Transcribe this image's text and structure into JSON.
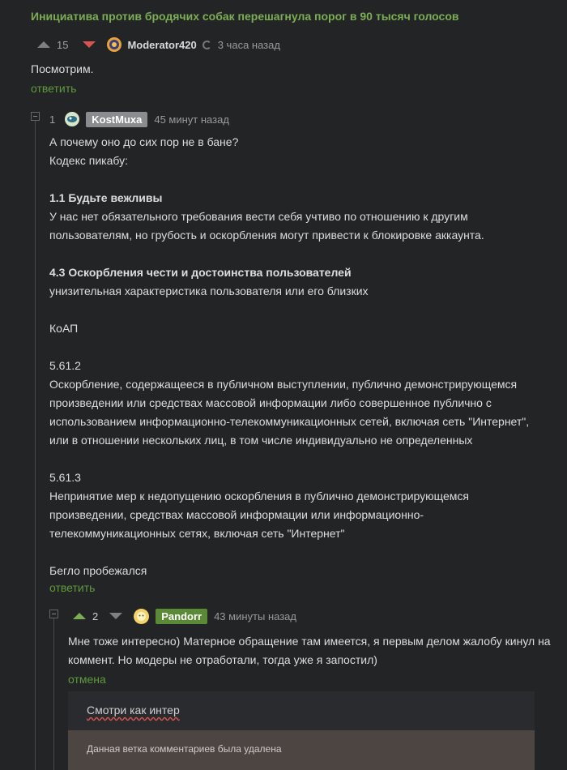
{
  "post": {
    "title": "Инициатива против бродячих собак перешагнула порог в 90 тысяч голосов"
  },
  "top_comment": {
    "votes": "15",
    "username": "Moderator420",
    "time": "3 часа назад",
    "text": "Посмотрим.",
    "reply_label": "ответить"
  },
  "comment2": {
    "votes": "1",
    "username": "KostMuxa",
    "time": "45 минут назад",
    "lines": [
      "А почему оно до сих пор не в бане?",
      "Кодекс пикабу:",
      "",
      "1.1 Будьте вежливы",
      "У нас нет обязательного требования вести себя учтиво по отношению к другим",
      "пользователям, но грубость и оскорбления могут привести к блокировке аккаунта.",
      "",
      "4.3 Оскорбления чести и достоинства пользователей",
      "унизительная характеристика пользователя или его близких",
      "",
      "КоАП",
      "",
      "5.61.2",
      "Оскорбление, содержащееся в публичном выступлении, публично демонстрирующемся",
      "произведении или средствах массовой информации либо совершенное публично с",
      "использованием информационно-телекоммуникационных сетей, включая сеть \"Интернет\",",
      "или в отношении нескольких лиц, в том числе индивидуально не определенных",
      "",
      "5.61.3",
      "Непринятие мер к недопущению оскорбления в публично демонстрирующемся",
      "произведении, средствах массовой информации или информационно-",
      "телекоммуникационных сетях, включая сеть \"Интернет\"",
      "",
      "Бегло пробежался"
    ],
    "reply_label": "ответить"
  },
  "comment3": {
    "votes": "2",
    "username": "Pandorr",
    "time": "43 минуты назад",
    "lines": [
      "Мне тоже интересно) Матерное обращение там имеется, я первым делом жалобу кинул на",
      "коммент. Но модеры не отработали, тогда уже я запостил)"
    ],
    "cancel_label": "отмена"
  },
  "reply_input": {
    "value": "Смотри как интер"
  },
  "deleted_notice": "Данная ветка комментариев была удалена",
  "colors": {
    "background": "#232426",
    "accent_green": "#7cad54",
    "downvote_red": "#d9534f"
  }
}
